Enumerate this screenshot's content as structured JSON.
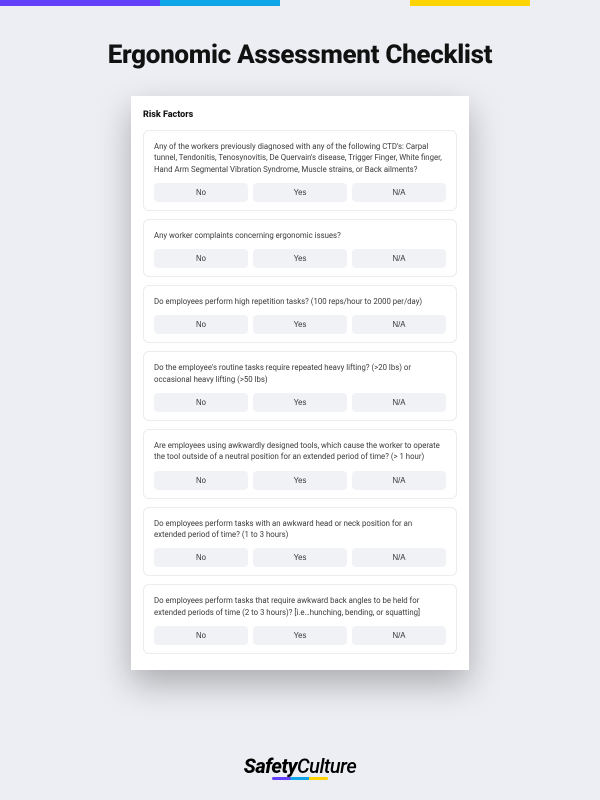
{
  "accent_bar": {
    "purple": "#6440FB",
    "blue": "#0ea5e9",
    "yellow": "#ffd400"
  },
  "title": "Ergonomic Assessment Checklist",
  "section_header": "Risk Factors",
  "answers": {
    "no": "No",
    "yes": "Yes",
    "na": "N/A"
  },
  "questions": [
    "Any of the workers previously diagnosed with any of the following CTD's: Carpal tunnel, Tendonitis, Tenosynovitis, De Quervain's disease, Trigger Finger, White finger, Hand Arm Segmental Vibration Syndrome, Muscle strains, or Back ailments?",
    "Any worker complaints concerning ergonomic issues?",
    "Do employees perform high repetition tasks? (100 reps/hour to 2000 per/day)",
    "Do the employee's routine tasks require repeated heavy lifting? (>20 lbs) or occasional heavy lifting (>50 lbs)",
    "Are employees using awkwardly designed tools, which cause the worker to operate the tool outside of a neutral position for an extended period of time? (> 1 hour)",
    "Do employees perform tasks with an awkward head or neck position for an extended period of time? (1 to 3 hours)",
    "Do employees perform tasks that require awkward back angles to be held for extended periods of time (2 to 3 hours)? [i.e…hunching, bending, or squatting]"
  ],
  "footer_brand": {
    "bold": "Safety",
    "light": "Culture"
  }
}
